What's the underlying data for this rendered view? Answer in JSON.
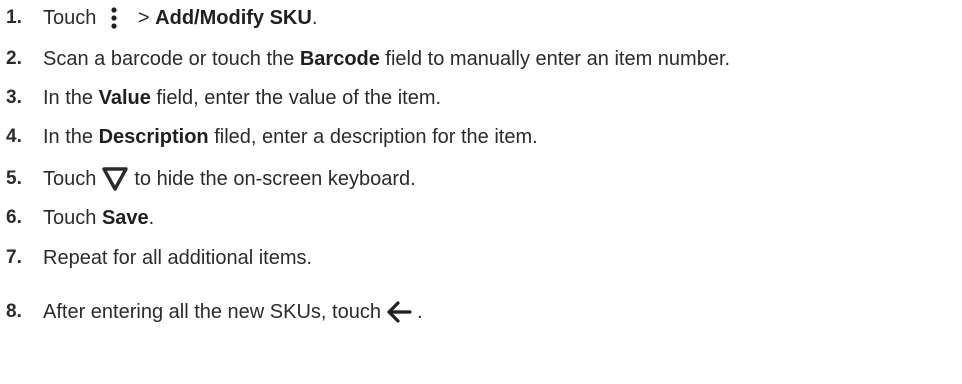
{
  "steps": [
    {
      "number": "1.",
      "pre": "Touch",
      "icon": "more-vertical-icon",
      "mid": " > ",
      "bold": "Add/Modify SKU",
      "post": "."
    },
    {
      "number": "2.",
      "pre": "Scan a barcode or touch the ",
      "bold": "Barcode",
      "post": " field to manually enter an item number."
    },
    {
      "number": "3.",
      "pre": "In the ",
      "bold": "Value",
      "post": " field, enter the value of the item."
    },
    {
      "number": "4.",
      "pre": "In the ",
      "bold": "Description",
      "post": " filed, enter a description for the item."
    },
    {
      "number": "5.",
      "pre": "Touch",
      "icon": "hide-keyboard-triangle-icon",
      "post": "to hide the on-screen keyboard."
    },
    {
      "number": "6.",
      "pre": "Touch ",
      "bold": "Save",
      "post": "."
    },
    {
      "number": "7.",
      "pre": "Repeat for all additional items."
    },
    {
      "number": "8.",
      "pre": "After entering all the new SKUs, touch",
      "icon": "back-arrow-icon",
      "post": "."
    }
  ]
}
